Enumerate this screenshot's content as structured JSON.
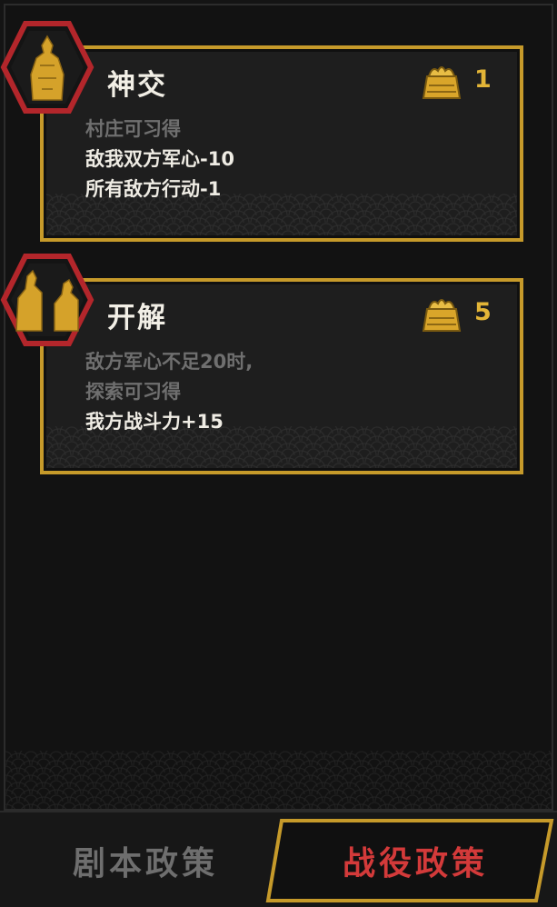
{
  "policies": [
    {
      "title": "神交",
      "cost": "1",
      "lines": [
        {
          "text": "村庄可习得",
          "muted": true
        },
        {
          "text": "敌我双方军心-10",
          "muted": false
        },
        {
          "text": "所有敌方行动-1",
          "muted": false
        }
      ]
    },
    {
      "title": "开解",
      "cost": "5",
      "lines": [
        {
          "text": "敌方军心不足20时,",
          "muted": true
        },
        {
          "text": "探索可习得",
          "muted": true
        },
        {
          "text": "我方战斗力+15",
          "muted": false
        }
      ]
    }
  ],
  "tabs": {
    "script_policy": "剧本政策",
    "campaign_policy": "战役政策"
  },
  "colors": {
    "gold": "#c69a2a",
    "emblem_red": "#b3262b",
    "active_tab_text": "#d33a3a"
  },
  "icons": {
    "cost": "gold-bag-icon",
    "emblem_1": "general-portrait-icon",
    "emblem_2": "two-figures-portrait-icon"
  }
}
